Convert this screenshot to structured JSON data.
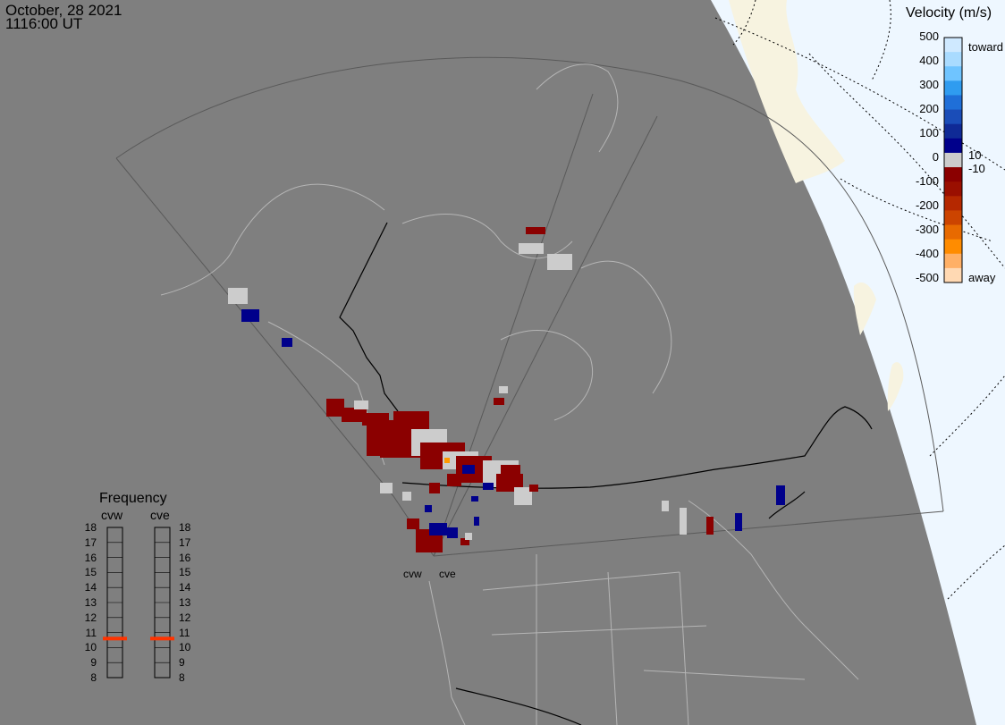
{
  "header": {
    "date": "October, 28 2021",
    "time": "1116:00 UT"
  },
  "velocity_legend": {
    "title": "Velocity (m/s)",
    "left_ticks": [
      "500",
      "400",
      "300",
      "200",
      "100",
      "0",
      "-100",
      "-200",
      "-300",
      "-400",
      "-500"
    ],
    "right_labels": {
      "toward": "toward",
      "ten_pos": "10",
      "ten_neg": "-10",
      "away": "away"
    }
  },
  "frequency_legend": {
    "title": "Frequency",
    "radars": [
      "cvw",
      "cve"
    ],
    "scale": [
      "18",
      "17",
      "16",
      "15",
      "14",
      "13",
      "12",
      "11",
      "10",
      "9",
      "8"
    ],
    "current_mhz": {
      "cvw": 10.6,
      "cve": 10.6
    },
    "marker_color": "#ff3300"
  },
  "radar_sites": {
    "west": "cvw",
    "east": "cve"
  },
  "colors": {
    "background": "#7f7f7f",
    "night_terminator": "#eef7ff",
    "land_sunlit": "#f7f3e0",
    "scatter_low": "#8b0000",
    "scatter_toward": "#00008b",
    "ground_scatter": "#cccccc"
  }
}
